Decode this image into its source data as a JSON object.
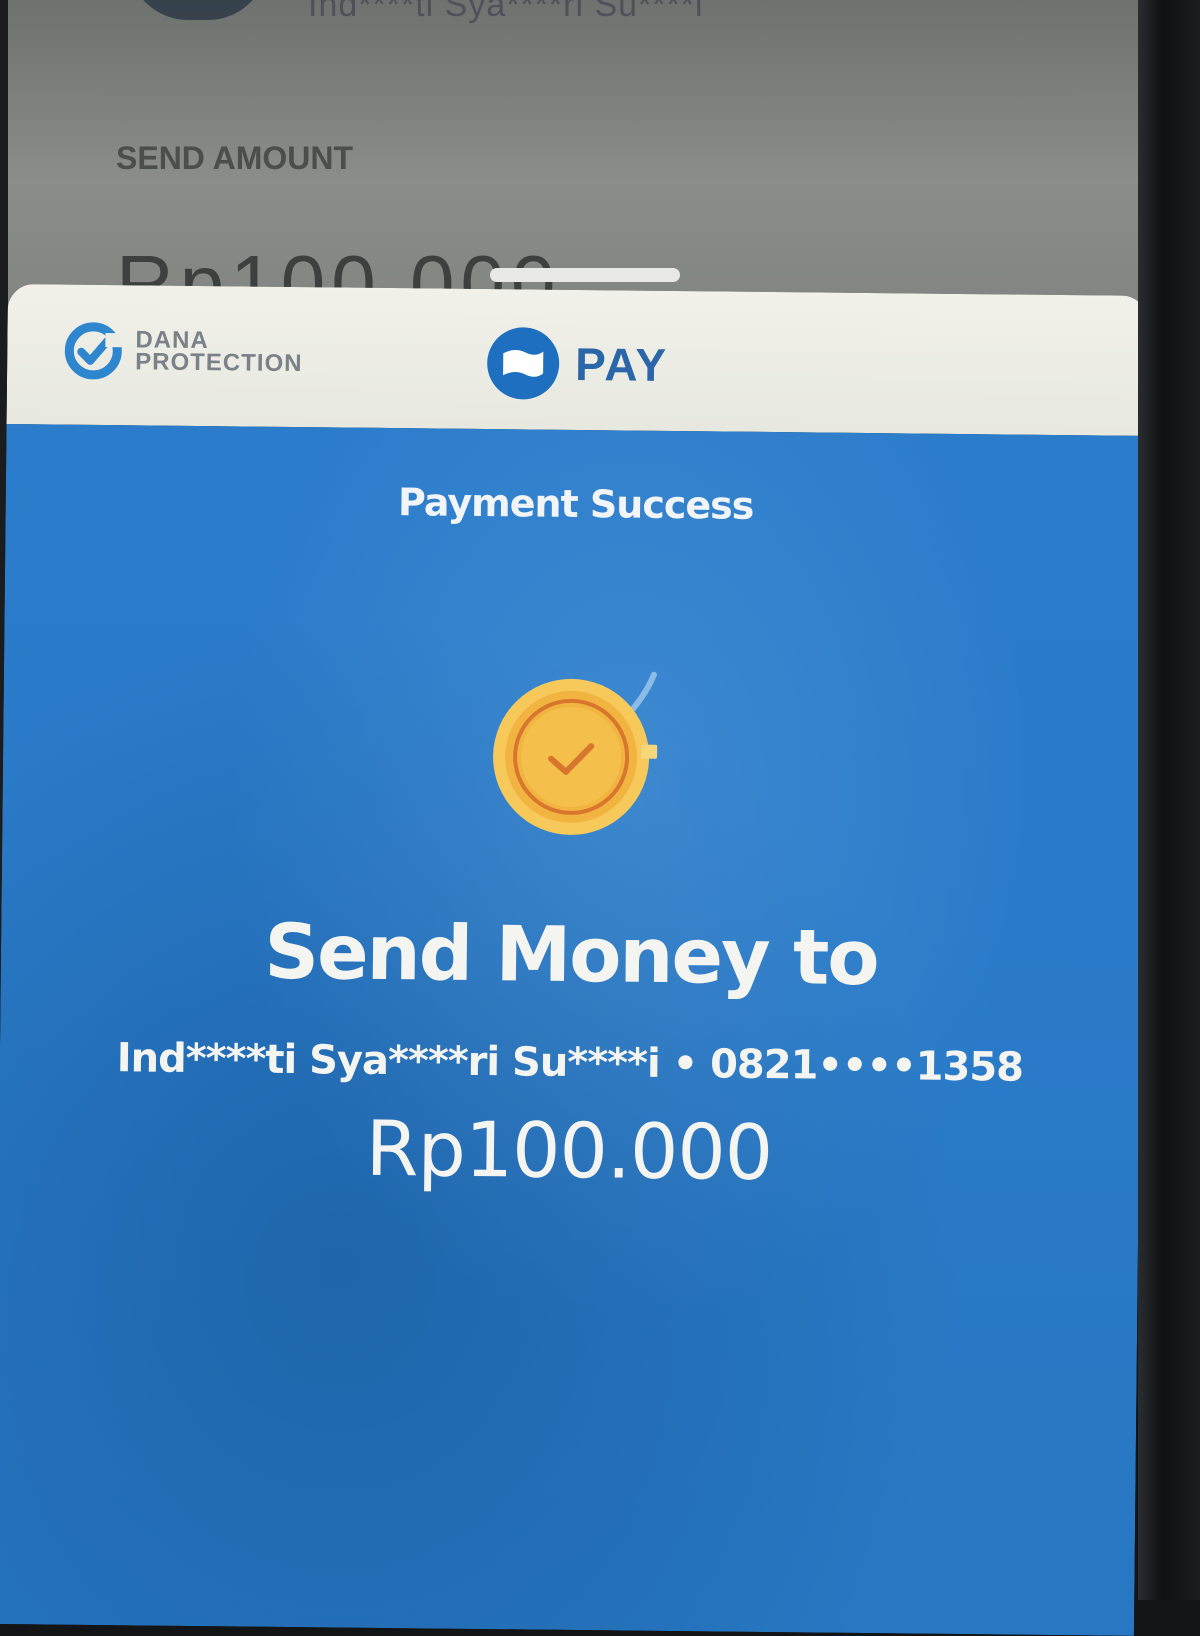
{
  "background_screen": {
    "recipient_partial": "Ind****ti Sya****ri Su****i",
    "send_amount_label": "SEND AMOUNT",
    "send_amount_value": "Rp100.000"
  },
  "header": {
    "protection_line1": "DANA",
    "protection_line2": "PROTECTION",
    "pay_label": "PAY"
  },
  "receipt": {
    "title": "Payment Success",
    "headline": "Send Money to",
    "recipient": "Ind****ti Sya****ri Su****i • 0821••••1358",
    "amount": "Rp100.000"
  },
  "colors": {
    "brand_blue": "#2b7ccb",
    "header_bg": "#f1f1ea",
    "coin_gold": "#f2b440"
  },
  "icons": {
    "protection": "shield-check-icon",
    "pay": "dana-wallet-icon",
    "success": "gold-coin-check-icon"
  }
}
